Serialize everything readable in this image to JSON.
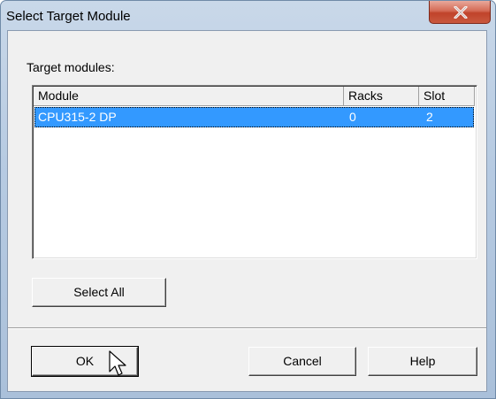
{
  "window": {
    "title": "Select Target Module",
    "close_icon": "close-icon"
  },
  "target_modules_label": "Target modules:",
  "table": {
    "columns": [
      "Module",
      "Racks",
      "Slot"
    ],
    "rows": [
      {
        "module": "CPU315-2 DP",
        "racks": "0",
        "slot": "2",
        "selected": true
      }
    ]
  },
  "buttons": {
    "select_all": "Select All",
    "ok": "OK",
    "cancel": "Cancel",
    "help": "Help"
  },
  "colors": {
    "selection": "#3399ff",
    "close_button": "#c9583f"
  }
}
